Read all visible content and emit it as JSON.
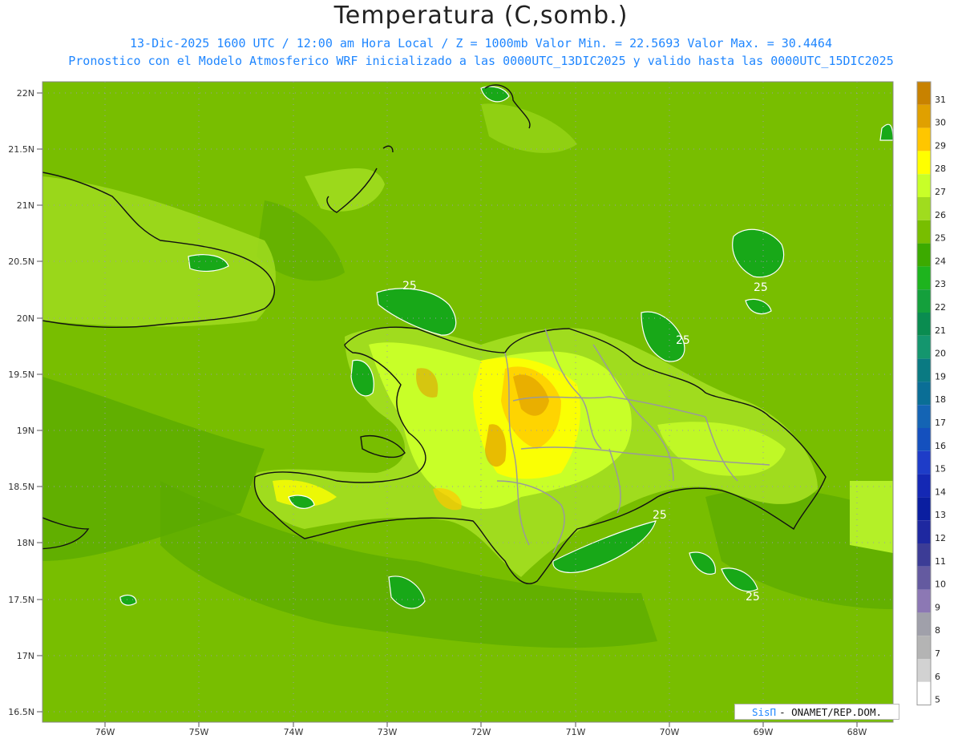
{
  "header": {
    "title": "Temperatura (C,somb.)",
    "line1": "13-Dic-2025 1600 UTC / 12:00 am Hora Local / Z = 1000mb  Valor Min. = 22.5693  Valor Max. = 30.4464",
    "line2": "Pronostico con el Modelo Atmosferico WRF inicializado a las 0000UTC_13DIC2025 y valido hasta las  0000UTC_15DIC2025"
  },
  "axes": {
    "lat_labels": [
      "22N",
      "21.5N",
      "21N",
      "20.5N",
      "20N",
      "19.5N",
      "19N",
      "18.5N",
      "18N",
      "17.5N",
      "17N",
      "16.5N"
    ],
    "lon_labels": [
      "76W",
      "75W",
      "74W",
      "73W",
      "72W",
      "71W",
      "70W",
      "69W",
      "68W"
    ]
  },
  "contour_labels": [
    "25",
    "25",
    "25",
    "25",
    "25"
  ],
  "colorbar": {
    "labels": [
      "31",
      "30",
      "29",
      "28",
      "27",
      "26",
      "25",
      "24",
      "23",
      "22",
      "21",
      "20",
      "19",
      "18",
      "17",
      "16",
      "15",
      "14",
      "13",
      "12",
      "11",
      "10",
      "9",
      "8",
      "7",
      "6",
      "5"
    ],
    "colors": [
      "#c88200",
      "#e0a000",
      "#ffc600",
      "#ffff00",
      "#c8ff28",
      "#a0dc1e",
      "#78be00",
      "#3caa00",
      "#1eb41e",
      "#14a03c",
      "#0a8c50",
      "#14966e",
      "#0a7a82",
      "#0a6e96",
      "#1464b4",
      "#1450be",
      "#1e3cc8",
      "#1428b4",
      "#0a1ea0",
      "#1e28a0",
      "#3c3c96",
      "#645aa0",
      "#8c78b4",
      "#a0a0aa",
      "#b4b4b4",
      "#d2d2d2",
      "#ffffff"
    ]
  },
  "legend_credit": {
    "brand": "SisΠ",
    "text": "- ONAMET/REP.DOM."
  }
}
